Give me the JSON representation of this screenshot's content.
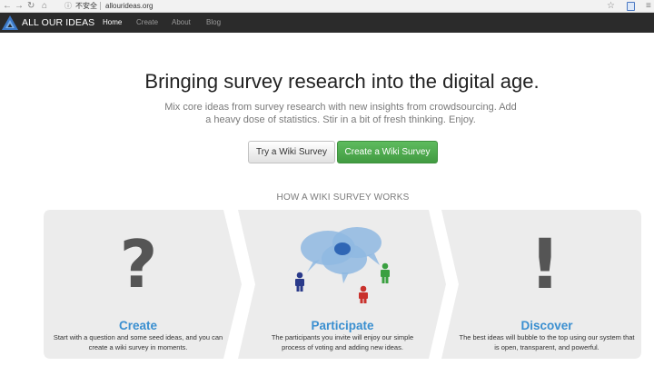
{
  "browser": {
    "security_label": "不安全",
    "url": "allourideas.org"
  },
  "navbar": {
    "brand": "ALL OUR IDEAS",
    "items": [
      {
        "label": "Home",
        "active": true
      },
      {
        "label": "Create",
        "active": false
      },
      {
        "label": "About",
        "active": false
      },
      {
        "label": "Blog",
        "active": false
      }
    ]
  },
  "hero": {
    "headline": "Bringing survey research into the digital age.",
    "lead": "Mix core ideas from survey research with new insights from crowdsourcing. Add a heavy dose of statistics. Stir in a bit of fresh thinking. Enjoy.",
    "try_button": "Try a Wiki Survey",
    "create_button": "Create a Wiki Survey"
  },
  "how_it_works": {
    "title": "HOW A WIKI SURVEY WORKS",
    "steps": [
      {
        "icon": "question-mark-icon",
        "title": "Create",
        "description": "Start with a question and some seed ideas, and you can create a wiki survey in moments."
      },
      {
        "icon": "people-ideas-icon",
        "title": "Participate",
        "description": "The participants you invite will enjoy our simple process of voting and adding new ideas."
      },
      {
        "icon": "exclamation-icon",
        "title": "Discover",
        "description": "The best ideas will bubble to the top using our system that is open, transparent, and powerful."
      }
    ]
  },
  "colors": {
    "navbar_bg": "#2b2b2b",
    "primary_green": "#47a447",
    "step_title_blue": "#3a8fd0",
    "panel_bg": "#ececec"
  }
}
